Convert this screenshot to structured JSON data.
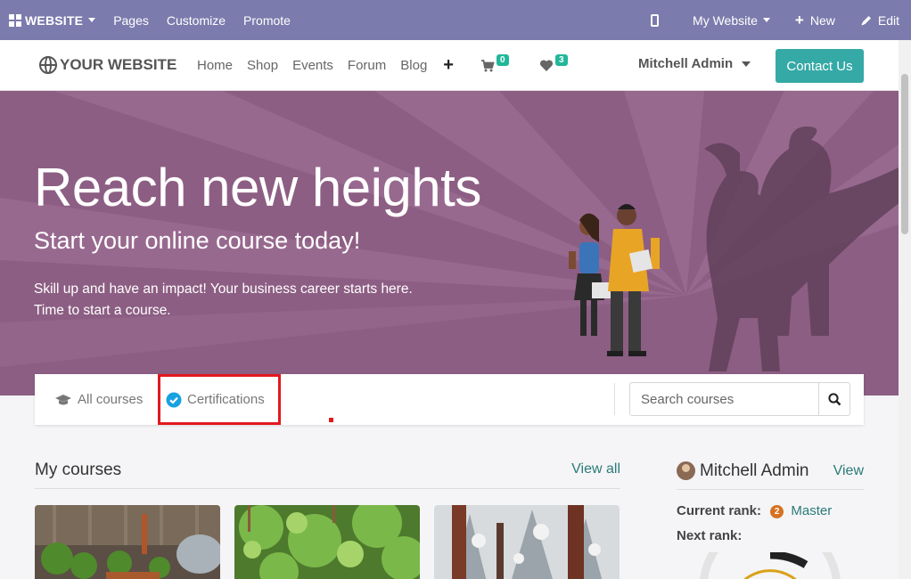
{
  "adminbar": {
    "apps_label": "WEBSITE",
    "menu": [
      "Pages",
      "Customize",
      "Promote"
    ],
    "site_selector": "My Website",
    "new_label": "New",
    "edit_label": "Edit"
  },
  "header": {
    "logo_text": "YOUR WEBSITE",
    "nav": [
      "Home",
      "Shop",
      "Events",
      "Forum",
      "Blog"
    ],
    "cart_count": "0",
    "wishlist_count": "3",
    "user_name": "Mitchell Admin",
    "contact_label": "Contact Us"
  },
  "hero": {
    "title": "Reach new heights",
    "subtitle": "Start your online course today!",
    "line1": "Skill up and have an impact! Your business career starts here.",
    "line2": "Time to start a course."
  },
  "tabs": {
    "all_courses": "All courses",
    "certifications": "Certifications",
    "search_placeholder": "Search courses"
  },
  "my_courses": {
    "heading": "My courses",
    "view_all": "View all"
  },
  "profile": {
    "name": "Mitchell Admin",
    "view": "View",
    "current_rank_label": "Current rank:",
    "rank_number": "2",
    "rank_name": "Master",
    "next_rank_label": "Next rank:"
  },
  "colors": {
    "admin_bar": "#7c7bad",
    "hero_bg": "#8d5e83",
    "accent": "#35a9a6",
    "badge": "#21b799",
    "highlight": "#e3181f"
  }
}
